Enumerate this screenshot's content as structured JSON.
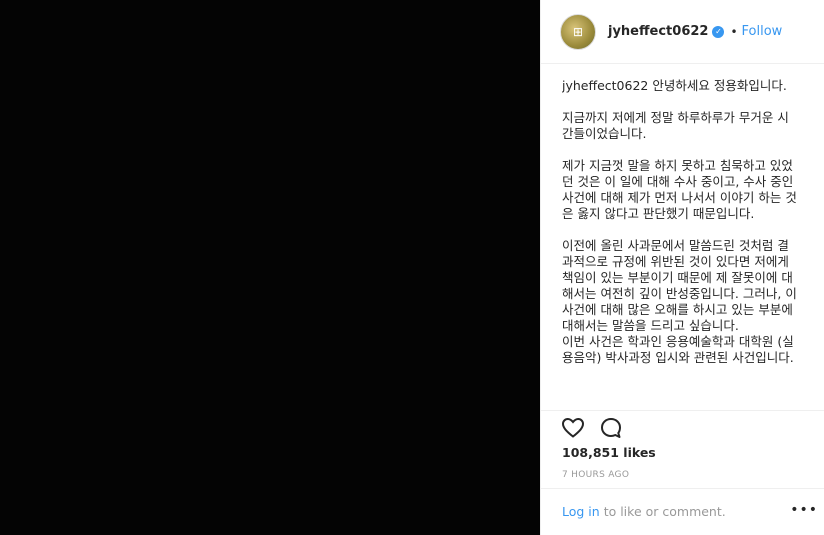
{
  "post": {
    "username": "jyheffect0622",
    "follow_label": "Follow",
    "separator": "•",
    "caption": {
      "lines": [
        "안녕하세요 정용화입니다.",
        "지금까지 저에게 정말 하루하루가 무거운 시간들이었습니다.",
        "제가 지금껏 말을 하지 못하고 침묵하고 있었던 것은 이 일에 대해 수사 중이고, 수사 중인 사건에 대해 제가 먼저 나서서 이야기 하는 것은 옳지 않다고 판단했기 때문입니다.",
        "이전에 올린 사과문에서 말씀드린 것처럼 결과적으로 규정에 위반된 것이 있다면 저에게 책임이 있는 부분이기 때문에 제 잘못이에 대해서는 여전히 깊이 반성중입니다. 그러나, 이 사건에 대해 많은 오해를 하시고 있는 부분에 대해서는 말씀을 드리고 싶습니다.\n이번 사건은 학과인 응용예술학과 대학원 (실용음악) 박사과정 입시와 관련된 사건입니다."
      ]
    },
    "likes": "108,851 likes",
    "time": "7 HOURS AGO",
    "login_link": "Log in",
    "login_rest": "to like or comment.",
    "more_label": "•••"
  },
  "icons": {
    "avatar": "profile-avatar",
    "verified": "verified-badge-icon",
    "like": "heart-icon",
    "comment": "comment-icon"
  },
  "colors": {
    "accent": "#3897f0",
    "text": "#262626",
    "muted": "#999999"
  }
}
